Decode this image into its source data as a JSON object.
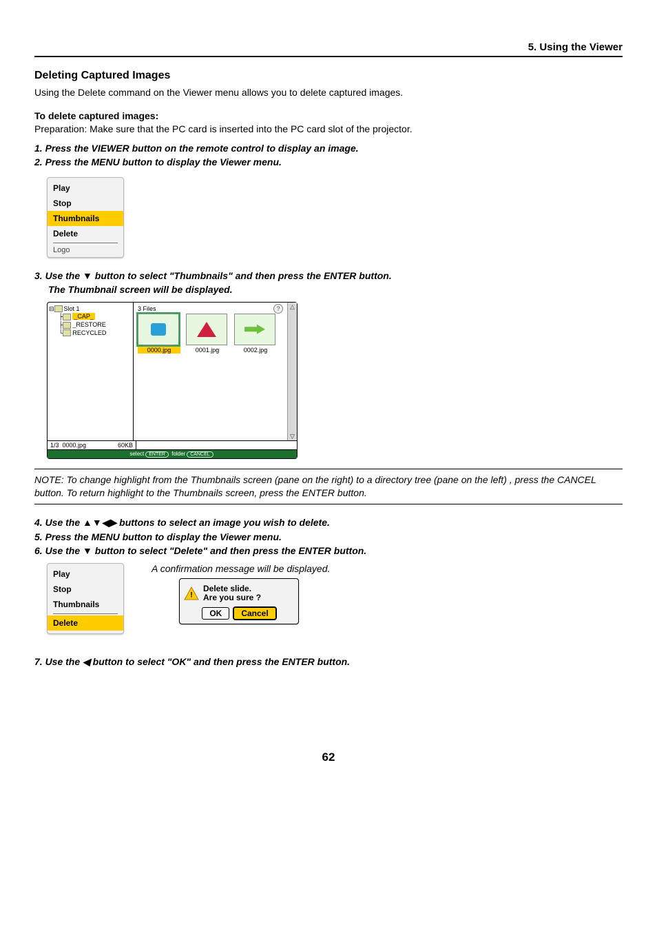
{
  "header": {
    "chapter": "5. Using the Viewer"
  },
  "section": {
    "title": "Deleting Captured Images",
    "intro": "Using the Delete command on the Viewer menu allows you to delete captured images.",
    "sub_heading": "To delete captured images:",
    "preparation": "Preparation: Make sure that the PC card is inserted into the PC card slot of the projector."
  },
  "steps": {
    "s1": "1.  Press the VIEWER button on the remote control to display an image.",
    "s2": "2.  Press the MENU button to display the Viewer menu.",
    "s3": "3.  Use the ▼ button to select \"Thumbnails\" and then press the ENTER button.",
    "s3b": "The Thumbnail screen will be displayed.",
    "s4": "4.  Use the ▲▼◀▶ buttons to select an image you wish to delete.",
    "s5": "5.  Press the MENU button to display the Viewer menu.",
    "s6": "6.  Use the ▼ button to select \"Delete\" and then press the ENTER button.",
    "s6note": "A confirmation message will be displayed.",
    "s7": "7.  Use the ◀ button to select \"OK\" and then press the ENTER button."
  },
  "note": "NOTE: To change highlight from the Thumbnails screen (pane on the right) to a directory tree (pane on the left) , press the CANCEL button. To return highlight to the Thumbnails screen, press the ENTER button.",
  "viewer_menu": {
    "items": [
      "Play",
      "Stop",
      "Thumbnails",
      "Delete"
    ],
    "highlight": "Thumbnails",
    "cutoff": "Logo"
  },
  "viewer_menu2": {
    "items": [
      "Play",
      "Stop",
      "Thumbnails",
      "Delete"
    ],
    "highlight": "Delete"
  },
  "thumbnails": {
    "tree": {
      "root": "Slot 1",
      "folders": [
        "_CAP_",
        "_RESTORE",
        "RECYCLED"
      ],
      "selected": "_CAP_"
    },
    "count_label": "3 Files",
    "files": [
      {
        "name": "0000.jpg",
        "selected": true
      },
      {
        "name": "0001.jpg",
        "selected": false
      },
      {
        "name": "0002.jpg",
        "selected": false
      }
    ],
    "status": {
      "index": "1/3",
      "file": "0000.jpg",
      "size": "60KB"
    },
    "hint": {
      "left": "select",
      "left_key": "ENTER",
      "right": "folder",
      "right_key": "CANCEL"
    },
    "help_icon": "?"
  },
  "confirm": {
    "line1": "Delete slide.",
    "line2": "Are you sure ?",
    "ok": "OK",
    "cancel": "Cancel"
  },
  "page_number": "62"
}
